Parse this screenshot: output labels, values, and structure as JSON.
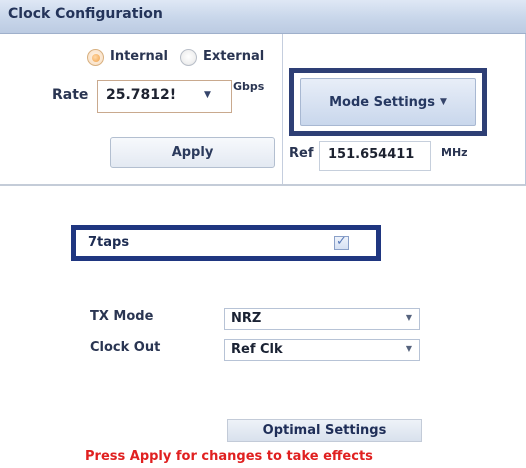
{
  "panel": {
    "title": "Clock Configuration",
    "clock_source": {
      "options": [
        "Internal",
        "External"
      ],
      "selected": "Internal"
    },
    "rate": {
      "label": "Rate",
      "value": "25.7812!",
      "unit": "Gbps"
    },
    "mode_settings_label": "Mode Settings",
    "apply_label": "Apply",
    "ref": {
      "label": "Ref",
      "value": "151.654411",
      "unit": "MHz"
    }
  },
  "taps": {
    "label": "7taps",
    "checked": true
  },
  "tx_mode": {
    "label": "TX Mode",
    "value": "NRZ"
  },
  "clock_out": {
    "label": "Clock Out",
    "value": "Ref Clk"
  },
  "optimal_settings_label": "Optimal Settings",
  "notice": "Press Apply for changes to take effects",
  "colors": {
    "frame_highlight": "#2e3f75",
    "notice_red": "#e02020"
  }
}
